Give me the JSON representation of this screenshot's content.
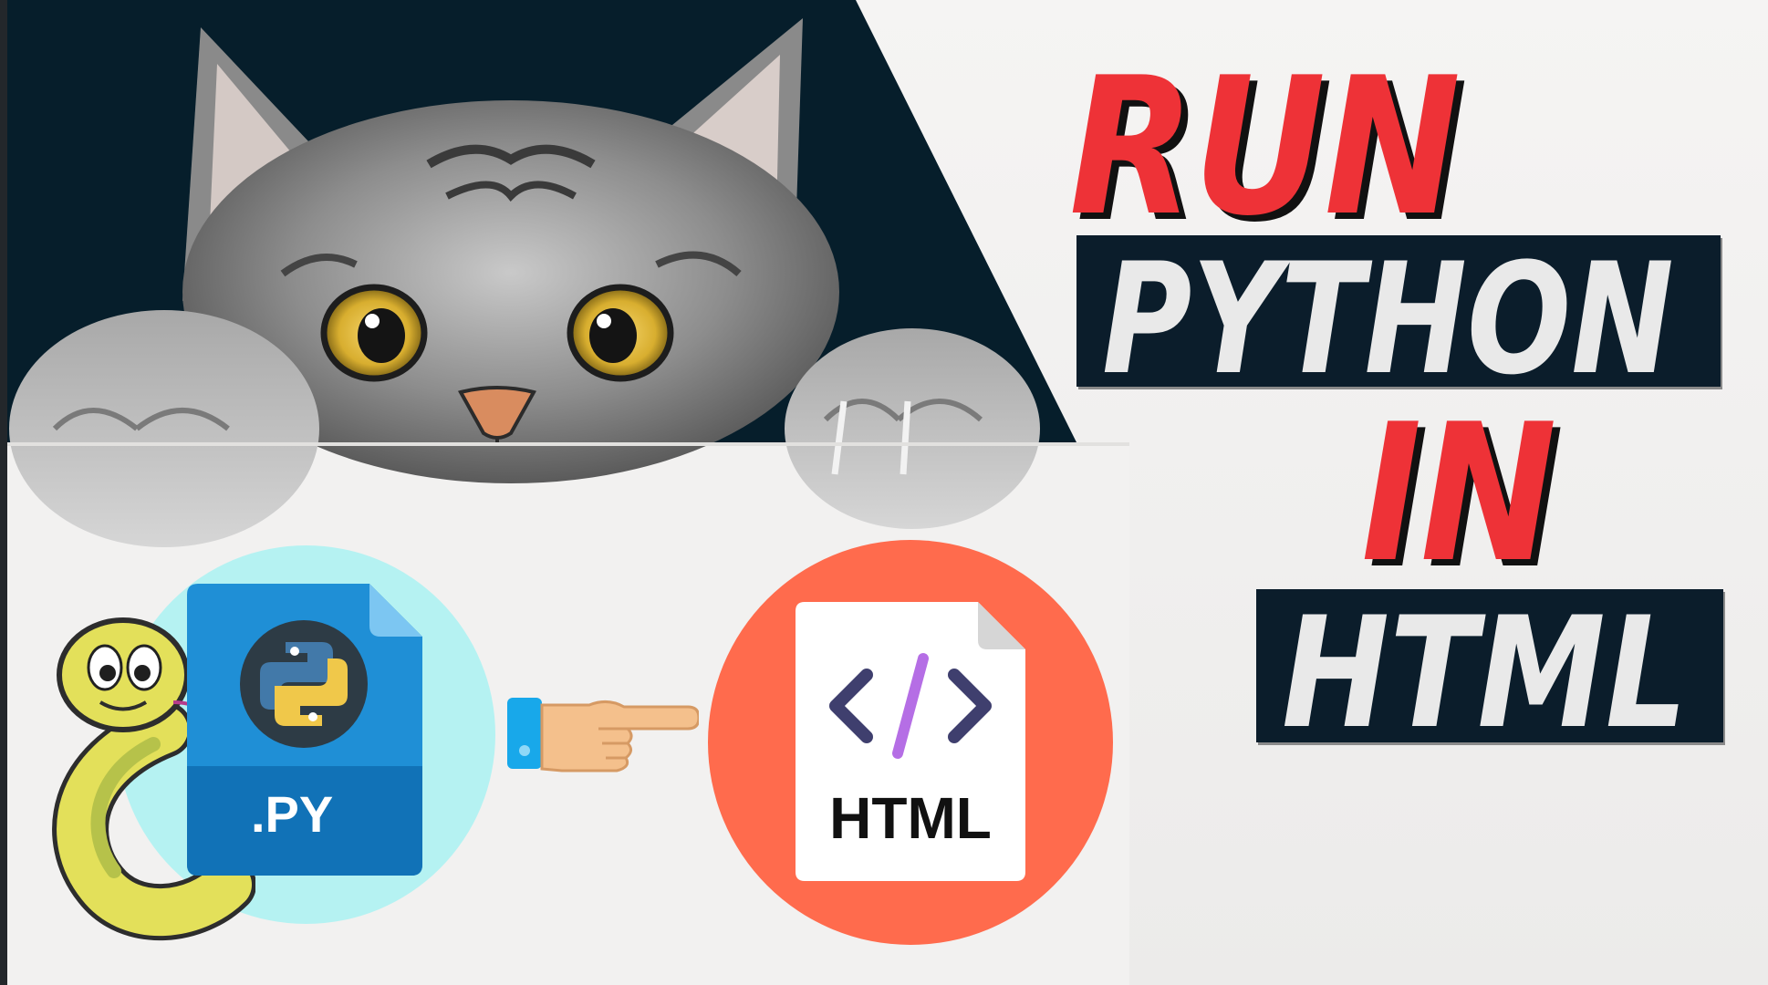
{
  "headline": {
    "run": "RUN",
    "python": "PYTHON",
    "in": "IN",
    "html": "HTML"
  },
  "colors": {
    "accent_red": "#ee3237",
    "navy": "#0b1d2b",
    "teal_circle": "#b5f2f2",
    "orange_circle": "#ff6b4d",
    "file_blue": "#1f8fd6"
  },
  "illustrations": {
    "cat": "cat-peeking-icon",
    "python_file": "python-file-icon",
    "html_file": "html-file-icon",
    "hand": "pointing-hand-icon",
    "snake": "snake-mascot-icon"
  },
  "python_file": {
    "extension": ".PY"
  },
  "html_file": {
    "label": "HTML"
  }
}
